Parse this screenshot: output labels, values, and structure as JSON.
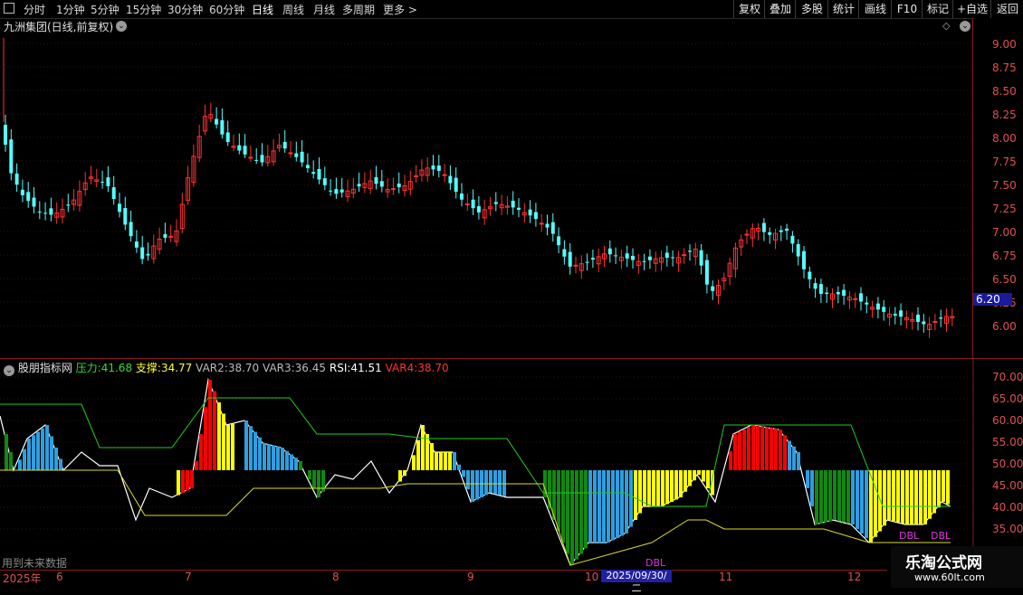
{
  "toolbar": {
    "periods": [
      "分时",
      "1分钟",
      "5分钟",
      "15分钟",
      "30分钟",
      "60分钟",
      "日线",
      "周线",
      "月线",
      "多周期",
      "更多 >"
    ],
    "active": "日线",
    "right_buttons": [
      "复权",
      "叠加",
      "多股",
      "统计",
      "画线",
      "F10",
      "标记",
      "+自选",
      "返回"
    ]
  },
  "price_pane": {
    "title": "九洲集团(日线,前复权)",
    "price_ticks": [
      "9.00",
      "8.75",
      "8.50",
      "8.25",
      "8.00",
      "7.75",
      "7.50",
      "7.25",
      "7.00",
      "6.75",
      "6.50",
      "6.25",
      "6.00"
    ],
    "current_price": "6.20"
  },
  "indicator": {
    "name": "股朋指标网",
    "items": [
      {
        "label": "压力:",
        "value": "41.68",
        "color": "#33dd33"
      },
      {
        "label": "支撑:",
        "value": "34.77",
        "color": "#ffff33"
      },
      {
        "label": "VAR2:",
        "value": "38.70",
        "color": "#bbbbbb"
      },
      {
        "label": "VAR3:",
        "value": "36.45",
        "color": "#bbbbbb"
      },
      {
        "label": "RSI:",
        "value": "41.51",
        "color": "#ffffff"
      },
      {
        "label": "VAR4:",
        "value": "38.70",
        "color": "#ff3333"
      }
    ],
    "ticks": [
      "70.00",
      "65.00",
      "60.00",
      "55.00",
      "50.00",
      "45.00",
      "40.00",
      "35.00"
    ],
    "dbl_labels": [
      "DBL",
      "DBL",
      "DBL"
    ],
    "future_note": "用到未来数据"
  },
  "date_axis": {
    "labels": [
      "2025年",
      "6",
      "7",
      "8",
      "9",
      "10",
      "11",
      "12"
    ],
    "highlight": "2025/09/30/二"
  },
  "watermark": {
    "title": "乐淘公式网",
    "url": "www.60lt.com"
  },
  "colors": {
    "up": "#ff3232",
    "down": "#54ffff",
    "axis": "#8b1a1a",
    "green": "#118811",
    "blue": "#2d9fe0",
    "yellow": "#ffff00",
    "red": "#ff0000"
  }
}
